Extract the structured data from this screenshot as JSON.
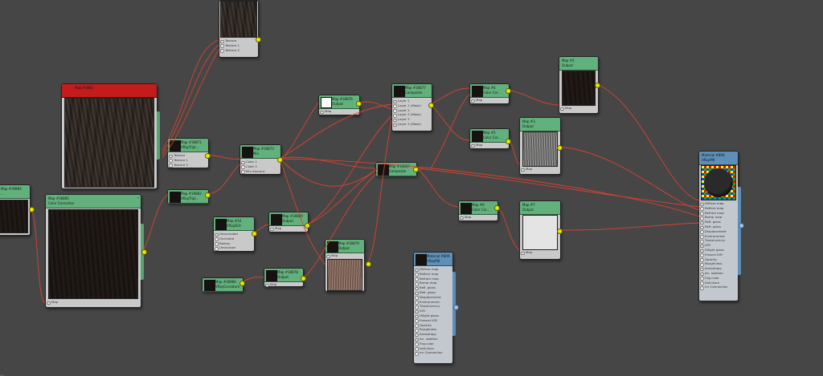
{
  "nodes": {
    "bitmap_top": {
      "rows": [
        "Texture",
        "Texture 1",
        "Texture 2"
      ]
    },
    "big_preview": {
      "title1": "Map #3001",
      "title2": ""
    },
    "n30871": {
      "title1": "Map #30871",
      "title2": "VRayTripl...",
      "rows": [
        "Texture",
        "Texture 1",
        "Texture 2"
      ]
    },
    "n30882": {
      "title1": "Map #30882",
      "title2": "VRayTripl..."
    },
    "left_edge": {
      "title1": "Map #30884",
      "title2": "..."
    },
    "color_corr_big": {
      "title1": "Map #30885",
      "title2": "Color Correction",
      "rows": [
        "Map"
      ]
    },
    "n30873": {
      "title1": "Map #30873",
      "title2": "Mix",
      "rows": [
        "Color 1",
        "Color 2",
        "Mix Amount"
      ]
    },
    "n30876": {
      "title1": "Map #30876",
      "title2": "Output",
      "rows": [
        "Map"
      ]
    },
    "n30877": {
      "title1": "Map #30877",
      "title2": "Composite",
      "rows": [
        "Layer 1",
        "Layer 1 (Mask)",
        "Layer 2",
        "Layer 2 (Mask)",
        "Layer 3",
        "Layer 3 (Mask)"
      ]
    },
    "n4": {
      "title1": "Map #4",
      "title2": "Color Cor...",
      "rows": [
        "Map"
      ]
    },
    "n5": {
      "title1": "Map #5",
      "title2": "Color Cor...",
      "rows": [
        "Map"
      ]
    },
    "n2": {
      "title1": "Map #2",
      "title2": "Output",
      "rows": [
        "Map"
      ]
    },
    "n3": {
      "title1": "Map #3",
      "title2": "Output",
      "rows": [
        "Map"
      ]
    },
    "n30887": {
      "title1": "Map #30887",
      "title2": "Composite"
    },
    "n30889": {
      "title1": "Map #30889",
      "title2": "Output",
      "rows": [
        "Map"
      ]
    },
    "n10": {
      "title1": "Map #10",
      "title2": "VRayDirt",
      "rows": [
        "Unoccluded",
        "Occluded",
        "Radius",
        "Unoccluse"
      ]
    },
    "n30878": {
      "title1": "Map #30878",
      "title2": "Output",
      "rows": [
        "Map"
      ]
    },
    "n30879": {
      "title1": "Map #30879",
      "title2": "Output",
      "rows": [
        "Map"
      ]
    },
    "n30880": {
      "title1": "Map #30880",
      "title2": "VRayCurvature"
    },
    "n6": {
      "title1": "Map #6",
      "title2": "Color Cor...",
      "rows": [
        "Map"
      ]
    },
    "n7": {
      "title1": "Map #7",
      "title2": "Output",
      "rows": [
        "Map"
      ]
    },
    "mat808": {
      "title1": "Material #808",
      "title2": "VRayMtl",
      "rows": [
        "Diffuse map",
        "Reflect map",
        "Refract map",
        "Bump map",
        "Refl. gloss",
        "Refr. gloss",
        "Displacement",
        "Environment",
        "Translucency",
        "IOR",
        "Hilight gloss",
        "Fresnel IOR",
        "Opacity",
        "Roughness",
        "Anisotropy",
        "An. rotation",
        "Fog color",
        "Self-illum",
        "mr Connection"
      ]
    },
    "mat809": {
      "title1": "Material #809",
      "title2": "VRayMtl",
      "rows": [
        "Diffuse map",
        "Reflect map",
        "Refract map",
        "Bump map",
        "Refl. gloss",
        "Refr. gloss",
        "Displacement",
        "Environment",
        "Translucency",
        "IOR",
        "Hilight gloss",
        "Fresnel IOR",
        "Opacity",
        "Roughness",
        "Anisotropy",
        "An. rotation",
        "Fog color",
        "Self-illum",
        "mr Connection"
      ]
    }
  },
  "colors": {
    "background": "#464646",
    "header": "#62b07c",
    "header_selected": "#c41b1b",
    "material_header": "#5e8fb8",
    "wire": "#d9422f",
    "port": "#e8e800"
  }
}
